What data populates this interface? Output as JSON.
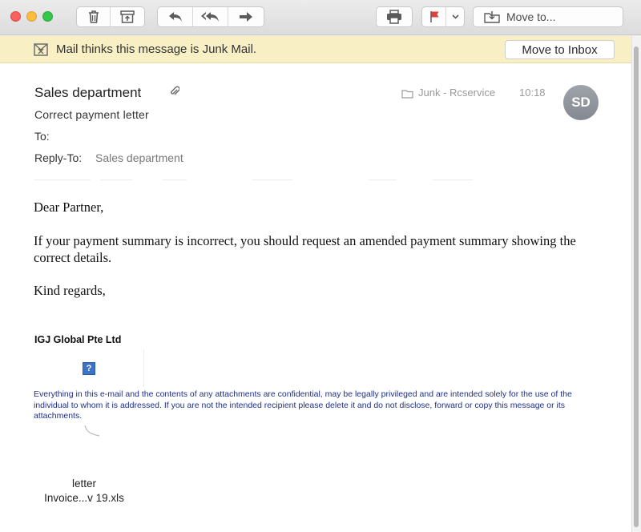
{
  "toolbar": {
    "move_to_label": "Move to..."
  },
  "junk_bar": {
    "message": "Mail thinks this message is Junk Mail.",
    "move_to_inbox_label": "Move to Inbox"
  },
  "header": {
    "sender": "Sales department",
    "subject": "Correct payment letter",
    "to_label": "To:",
    "reply_to_label": "Reply-To:",
    "reply_to_value": "Sales department",
    "mailbox": "Junk - Rcservice",
    "time": "10:18",
    "avatar_initials": "SD"
  },
  "body": {
    "greeting": "Dear Partner,",
    "paragraph": "If your payment summary is incorrect, you should request an amended payment summary showing the correct details.",
    "closing": "Kind regards,",
    "company": "IGJ Global Pte Ltd",
    "missing_image_glyph": "?",
    "disclaimer": "Everything in this e-mail and the contents of any attachments are confidential, may be legally privileged and are intended solely for the use of the individual to whom it is addressed.  If you are not the intended recipient please delete it and do not disclose, forward or copy this message or its attachments."
  },
  "attachment": {
    "name_line1": "letter",
    "name_line2": "Invoice...v 19.xls"
  },
  "colors": {
    "junk_bar_bg": "#f8efc5",
    "flag": "#e0403a",
    "disclaimer_text": "#1f2f8a",
    "avatar_bg": "#8e9299"
  },
  "icons": {
    "toolbar": [
      "trash-icon",
      "archive-icon",
      "reply-icon",
      "reply-all-icon",
      "forward-icon",
      "print-icon",
      "flag-icon",
      "chevron-down-icon",
      "move-to-icon"
    ],
    "header": [
      "paperclip-icon",
      "folder-icon"
    ],
    "junk_bar": [
      "junk-icon"
    ]
  }
}
